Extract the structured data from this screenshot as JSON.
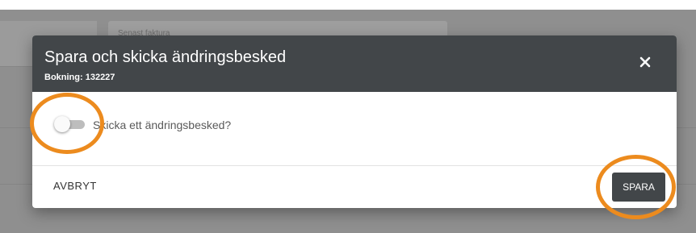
{
  "background": {
    "field_label": "Senast faktura"
  },
  "modal": {
    "title": "Spara och skicka ändringsbesked",
    "subtitle": "Bokning: 132227",
    "close_icon": "close-icon",
    "toggle": {
      "label": "Skicka ett ändringsbesked?",
      "checked": false
    },
    "cancel_label": "AVBRYT",
    "save_label": "SPARA"
  },
  "colors": {
    "header_bg": "#424649",
    "save_button_bg": "#424649",
    "highlight": "#ec8b1e",
    "backdrop": "#8f8f8f"
  }
}
